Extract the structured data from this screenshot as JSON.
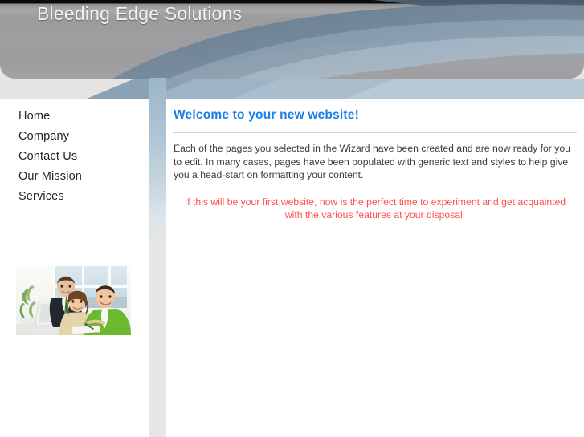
{
  "header": {
    "site_title": "Bleeding Edge Solutions",
    "title_color": "#f2f2f2",
    "banner_base_color": "#9d9d9f",
    "arc_colors": [
      "#5d7285",
      "#6c8295",
      "#8fa3b4",
      "#a3b6c6",
      "#9ba9b4"
    ]
  },
  "sidebar": {
    "nav": [
      {
        "label": "Home"
      },
      {
        "label": "Company"
      },
      {
        "label": "Contact Us"
      },
      {
        "label": "Our Mission"
      },
      {
        "label": "Services"
      }
    ],
    "photo": {
      "alt": "three business people smiling at a laptop in a bright office"
    }
  },
  "divider": {
    "top_color": "#9cb6ca",
    "bottom_color": "#e6e6e6"
  },
  "main": {
    "heading": "Welcome to your new website!",
    "heading_color": "#1a7fe8",
    "paragraph": "Each of the pages you selected in the Wizard have been created and are now ready for you to edit. In many cases, pages have been populated with generic text and styles to help give you a head-start on formatting your content.",
    "tip": "If this will be your first website, now is the perfect time to experiment and get acquainted with the various features at your disposal.",
    "tip_color": "#ff4f4f"
  }
}
